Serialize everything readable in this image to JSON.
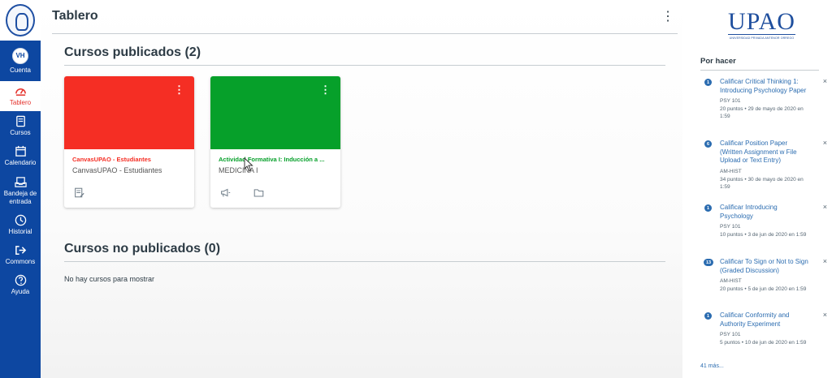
{
  "nav": {
    "account": {
      "initials": "VH",
      "label": "Cuenta"
    },
    "dashboard": {
      "label": "Tablero"
    },
    "courses": {
      "label": "Cursos"
    },
    "calendar": {
      "label": "Calendario"
    },
    "inbox": {
      "label": "Bandeja de entrada"
    },
    "history": {
      "label": "Historial"
    },
    "commons": {
      "label": "Commons"
    },
    "help": {
      "label": "Ayuda"
    },
    "colors": {
      "background": "#0d47a1",
      "active_text": "#e4312b"
    }
  },
  "header": {
    "title": "Tablero"
  },
  "published": {
    "title": "Cursos publicados (2)",
    "cards": [
      {
        "color": "#f52e24",
        "link": "CanvasUPAO - Estudiantes",
        "subtitle": "CanvasUPAO - Estudiantes",
        "actions": [
          "assignments-icon"
        ]
      },
      {
        "color": "#06a02a",
        "link": "Actividad Formativa I: Inducción a ...",
        "subtitle": "MEDICINA I",
        "actions": [
          "announcements-icon",
          "files-icon"
        ]
      }
    ]
  },
  "unpublished": {
    "title": "Cursos no publicados (0)",
    "empty": "No hay cursos para mostrar"
  },
  "brand": {
    "name": "UPAO",
    "subtitle": "UNIVERSIDAD PRIVADA ANTENOR ORREGO"
  },
  "todo": {
    "heading": "Por hacer",
    "items": [
      {
        "badge": "1",
        "title": "Calificar Critical Thinking 1: Introducing Psychology Paper",
        "course": "PSY 101",
        "meta": "20 puntos • 29 de mayo de 2020 en 1:59"
      },
      {
        "badge": "6",
        "title": "Calificar Position Paper (Written Assignment w File Upload or Text Entry)",
        "course": "AM-HIST",
        "meta": "34 puntos • 30 de mayo de 2020 en 1:59"
      },
      {
        "badge": "1",
        "title": "Calificar Introducing Psychology",
        "course": "PSY 101",
        "meta": "10 puntos • 3 de jun de 2020 en 1:59"
      },
      {
        "badge": "13",
        "title": "Calificar To Sign or Not to Sign (Graded Discussion)",
        "course": "AM-HIST",
        "meta": "20 puntos • 5 de jun de 2020 en 1:59"
      },
      {
        "badge": "1",
        "title": "Calificar Conformity and Authority Experiment",
        "course": "PSY 101",
        "meta": "5 puntos • 10 de jun de 2020 en 1:59"
      }
    ],
    "more": "41 más..."
  }
}
